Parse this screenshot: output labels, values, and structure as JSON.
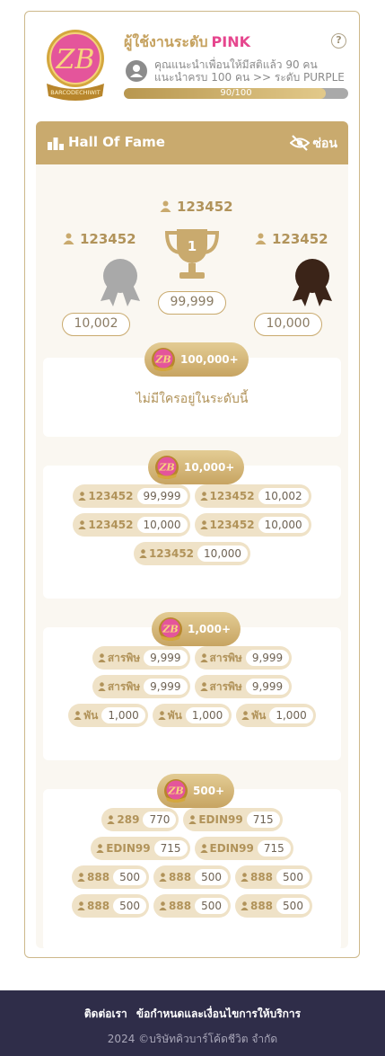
{
  "header": {
    "level_prefix": "ผู้ใช้งานระดับ",
    "level_name": "PINK",
    "info_line1": "คุณแนะนำเพื่อนให้มีสติแล้ว 90 คน",
    "info_line2": "แนะนำครบ 100 คน >> ระดับ PURPLE",
    "progress_label": "90/100",
    "progress_fraction": 0.9,
    "logo_text": "BARCODECHIWIT"
  },
  "hall_of_fame": {
    "title": "Hall Of Fame",
    "hide_label": "ซ่อน",
    "podium": {
      "first": {
        "name": "123452",
        "value": "99,999"
      },
      "second": {
        "name": "123452",
        "value": "10,002"
      },
      "third": {
        "name": "123452",
        "value": "10,000"
      }
    },
    "tiers": [
      {
        "badge": "100,000+",
        "empty_message": "ไม่มีใครอยู่ในระดับนี้",
        "rows": []
      },
      {
        "badge": "10,000+",
        "rows": [
          [
            {
              "name": "123452",
              "value": "99,999"
            },
            {
              "name": "123452",
              "value": "10,002"
            }
          ],
          [
            {
              "name": "123452",
              "value": "10,000"
            },
            {
              "name": "123452",
              "value": "10,000"
            }
          ],
          [
            {
              "name": "123452",
              "value": "10,000"
            }
          ]
        ]
      },
      {
        "badge": "1,000+",
        "rows": [
          [
            {
              "name": "สารพิษ",
              "value": "9,999"
            },
            {
              "name": "สารพิษ",
              "value": "9,999"
            }
          ],
          [
            {
              "name": "สารพิษ",
              "value": "9,999"
            },
            {
              "name": "สารพิษ",
              "value": "9,999"
            }
          ],
          [
            {
              "name": "พัน",
              "value": "1,000"
            },
            {
              "name": "พัน",
              "value": "1,000"
            },
            {
              "name": "พัน",
              "value": "1,000"
            }
          ]
        ]
      },
      {
        "badge": "500+",
        "rows": [
          [
            {
              "name": "289",
              "value": "770"
            },
            {
              "name": "EDIN99",
              "value": "715"
            }
          ],
          [
            {
              "name": "EDIN99",
              "value": "715"
            },
            {
              "name": "EDIN99",
              "value": "715"
            }
          ],
          [
            {
              "name": "888",
              "value": "500"
            },
            {
              "name": "888",
              "value": "500"
            },
            {
              "name": "888",
              "value": "500"
            }
          ],
          [
            {
              "name": "888",
              "value": "500"
            },
            {
              "name": "888",
              "value": "500"
            },
            {
              "name": "888",
              "value": "500"
            }
          ]
        ]
      }
    ]
  },
  "footer": {
    "contact": "ติดต่อเรา",
    "terms": "ข้อกำหนดและเงื่อนไขการให้บริการ",
    "copyright": "2024 ©บริษัทคิวบาร์โค้ดชีวิต จำกัด"
  },
  "colors": {
    "gold": "#c9aa6e",
    "pink": "#e6468e",
    "footer": "#2f2d49"
  }
}
